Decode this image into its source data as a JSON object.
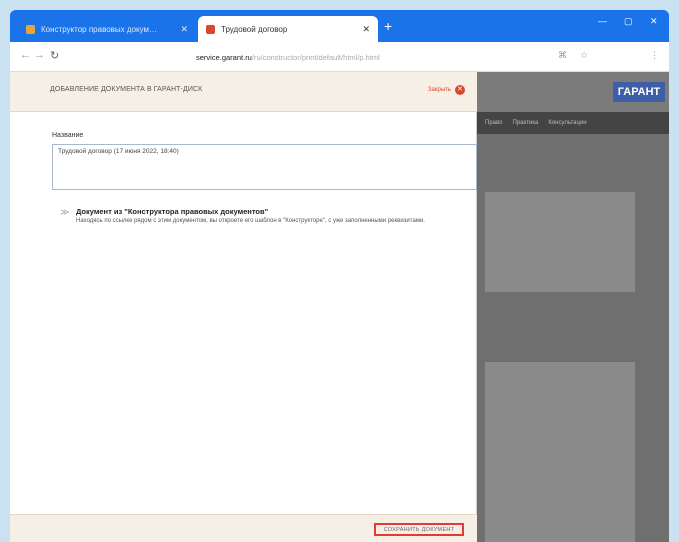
{
  "browser": {
    "tabs": [
      {
        "title": "Конструктор правовых докум…",
        "active": false,
        "icon_color": "#e8a33a"
      },
      {
        "title": "Трудовой договор",
        "active": true,
        "icon_color": "#d64a2b"
      }
    ],
    "new_tab_glyph": "+",
    "url_host": "service.garant.ru",
    "url_path": "/ru/constructor/print/default/html/p.html",
    "window_controls": [
      "—",
      "▢",
      "✕"
    ]
  },
  "modal": {
    "title": "ДОБАВЛЕНИЕ ДОКУМЕНТА В ГАРАНТ-ДИСК",
    "close_label": "Закрыть",
    "close_glyph": "✕",
    "name_label": "Название",
    "name_value": "Трудовой договор (17 июня 2022, 18:40)",
    "option_arrow": "≫",
    "option_title": "Документ из \"Конструктора правовых документов\"",
    "option_desc": "Находясь по ссылке рядом с этим документом, вы откроете его шаблон в \"Конструкторе\", с уже заполненными реквизитами.",
    "save_label": "СОХРАНИТЬ ДОКУМЕНТ"
  },
  "background_site": {
    "logo": "ГАРАНТ",
    "nav": [
      "Право",
      "Практика",
      "Консультации"
    ]
  },
  "colors": {
    "browser_chrome": "#1a73e8",
    "modal_header": "#f6efe6",
    "close_accent": "#d64a2b",
    "highlight_border": "#e53935"
  }
}
